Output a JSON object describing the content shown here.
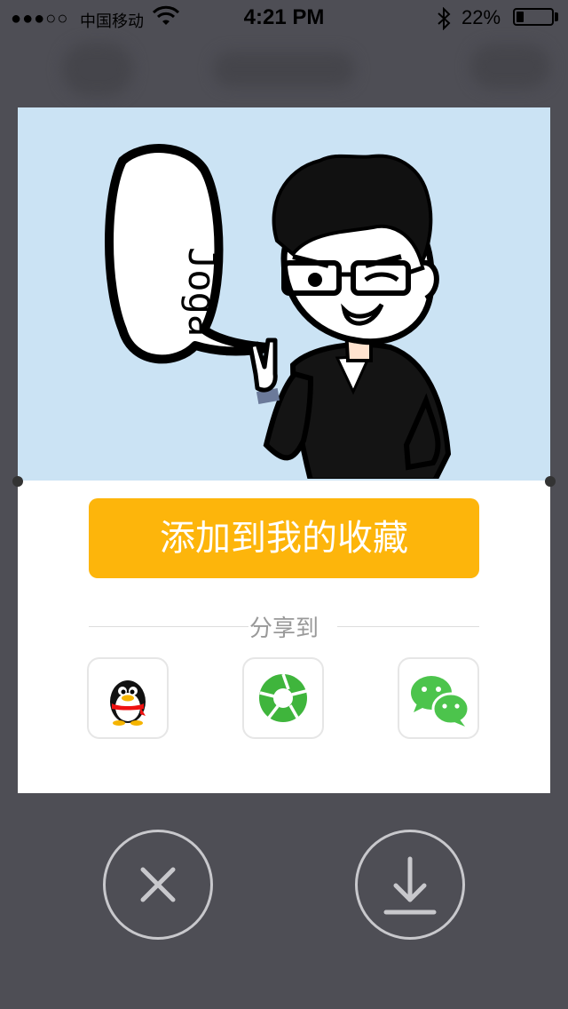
{
  "status_bar": {
    "signal": "●●●○○",
    "carrier": "中国移动",
    "time": "4:21 PM",
    "battery_percent": "22%",
    "battery_level": 0.22
  },
  "card": {
    "speech_bubble_text": "Joga",
    "favorite_button_label": "添加到我的收藏",
    "share_label": "分享到",
    "share_targets": [
      {
        "name": "QQ",
        "icon": "qq-penguin-icon"
      },
      {
        "name": "QQ空间",
        "icon": "aperture-icon"
      },
      {
        "name": "微信",
        "icon": "wechat-icon"
      }
    ]
  },
  "actions": {
    "close_icon": "close-icon",
    "download_icon": "download-icon"
  },
  "colors": {
    "background": "#4e4e55",
    "accent": "#fdb50b",
    "illustration_bg": "#cbe3f4",
    "wechat_green": "#4cc44c",
    "aperture_green": "#3fb53c"
  }
}
